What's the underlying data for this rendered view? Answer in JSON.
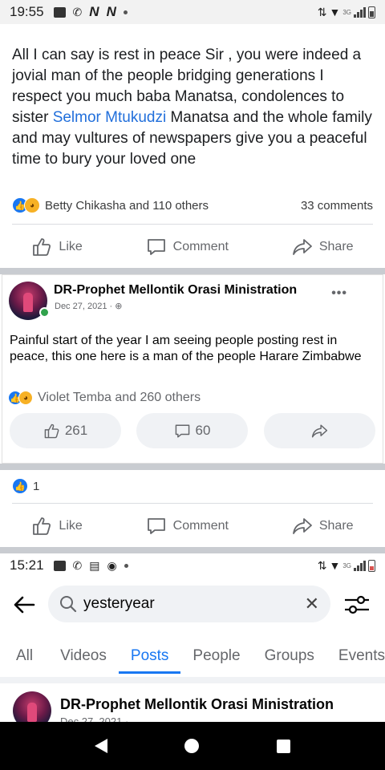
{
  "status_top": {
    "time": "19:55",
    "network": "3G"
  },
  "comment": {
    "text_before": "All I can say is rest in peace Sir , you were indeed a jovial man of the people bridging generations I respect you much baba Manatsa, condolences to sister ",
    "mention": "Selmor Mtukudzi",
    "text_after": " Manatsa and the whole family and may vultures of newspapers give you a peaceful time to bury your loved one"
  },
  "reactions_1": {
    "summary": "Betty Chikasha and 110 others",
    "comments": "33 comments"
  },
  "actions": {
    "like": "Like",
    "comment": "Comment",
    "share": "Share"
  },
  "shared_post": {
    "author": "DR-Prophet Mellontik Orasi Ministration",
    "date": "Dec 27, 2021 ·",
    "more": "•••",
    "text": "Painful start of the year I am seeing people posting rest in peace, this one here is a man of the people Harare Zimbabwe",
    "reactions_summary": "Violet Temba and 260 others",
    "like_count": "261",
    "comment_count": "60"
  },
  "reactions_2": {
    "count": "1"
  },
  "status_mid": {
    "time": "15:21",
    "network": "3G"
  },
  "search": {
    "query": "yesteryear"
  },
  "tabs": [
    "All",
    "Videos",
    "Posts",
    "People",
    "Groups",
    "Events"
  ],
  "active_tab": "Posts",
  "result": {
    "author": "DR-Prophet Mellontik Orasi Ministration",
    "date": "Dec 27, 2021 ·"
  },
  "colors": {
    "accent": "#1877f2",
    "link": "#216fdb",
    "online": "#31a24c"
  }
}
